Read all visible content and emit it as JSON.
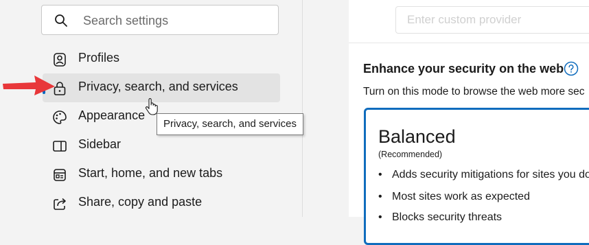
{
  "search": {
    "placeholder": "Search settings"
  },
  "nav": {
    "items": [
      {
        "label": "Profiles",
        "icon": "profile-icon"
      },
      {
        "label": "Privacy, search, and services",
        "icon": "lock-icon",
        "selected": true
      },
      {
        "label": "Appearance",
        "icon": "palette-icon"
      },
      {
        "label": "Sidebar",
        "icon": "sidebar-icon"
      },
      {
        "label": "Start, home, and new tabs",
        "icon": "home-tabs-icon"
      },
      {
        "label": "Share, copy and paste",
        "icon": "share-icon"
      }
    ]
  },
  "tooltip": {
    "text": "Privacy, search, and services"
  },
  "content": {
    "provider_placeholder": "Enter custom provider",
    "security_title": "Enhance your security on the web",
    "security_desc": "Turn on this mode to browse the web more sec",
    "card": {
      "title": "Balanced",
      "subtitle": "(Recommended)",
      "bullets": [
        "Adds security mitigations for sites you do",
        "Most sites work as expected",
        "Blocks security threats"
      ]
    }
  },
  "colors": {
    "accent": "#0f6cbd",
    "arrow": "#e8373a",
    "selected_bg": "#e3e3e3"
  }
}
